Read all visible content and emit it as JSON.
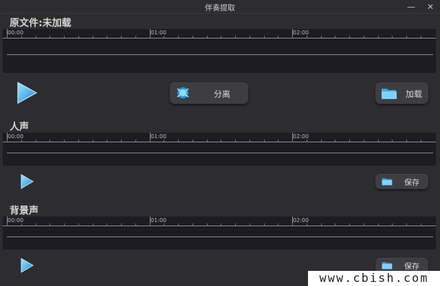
{
  "window": {
    "title": "伴奏提取",
    "minimize_glyph": "—",
    "close_glyph": "✕"
  },
  "original": {
    "label": "原文件:未加载",
    "ticks": [
      "00:00",
      "01:00",
      "02:00"
    ]
  },
  "vocals": {
    "label": "人声",
    "ticks": [
      "00:00",
      "01:00",
      "02:00"
    ]
  },
  "background": {
    "label": "背景声",
    "ticks": [
      "00:00",
      "01:00",
      "02:00"
    ]
  },
  "buttons": {
    "separate_label": "分离",
    "load_label": "加载",
    "save_vocals_label": "保存",
    "save_background_label": "保存"
  },
  "icons": {
    "play": "play-icon",
    "separate": "separate-icon",
    "folder": "folder-icon"
  },
  "colors": {
    "accent_blue": "#3fb8f0",
    "waveform_bg": "#1d1c22",
    "panel_bg": "#2d2d30",
    "button_bg": "#3e3e42"
  },
  "watermark": "www.cbish.com"
}
